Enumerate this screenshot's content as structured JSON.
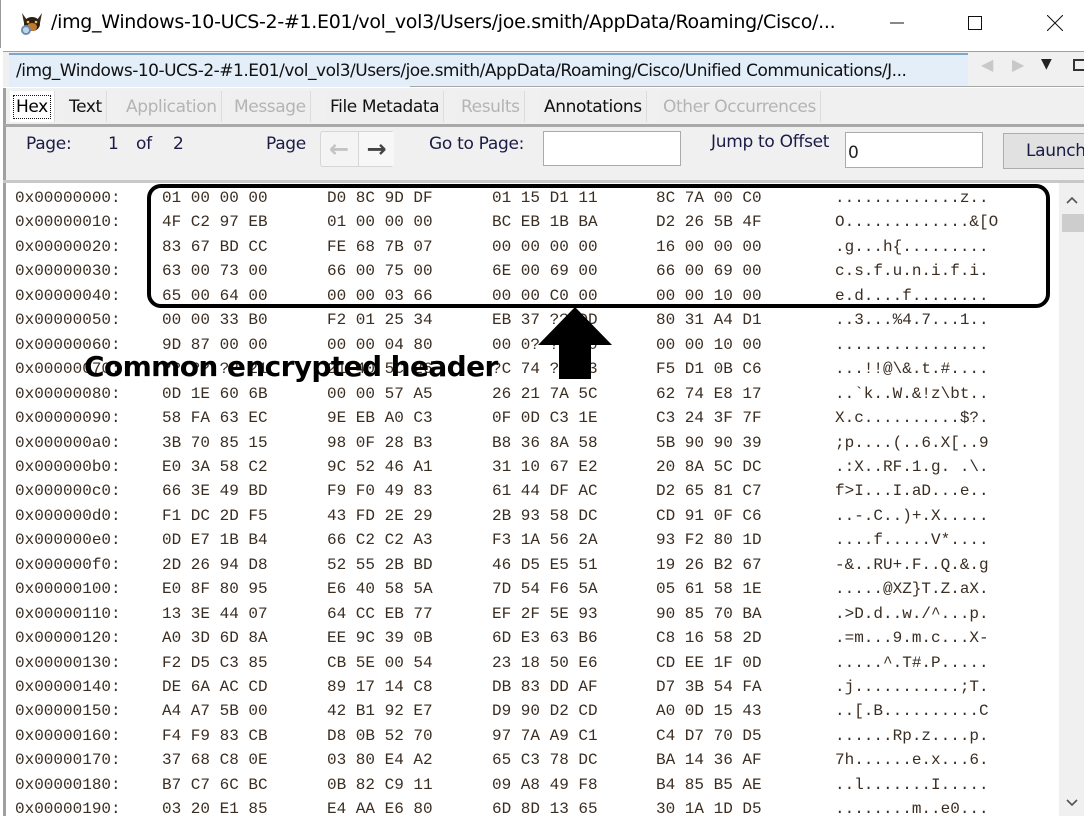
{
  "window": {
    "title": "/img_Windows-10-UCS-2-#1.E01/vol_vol3/Users/joe.smith/AppData/Roaming/Cisco/...",
    "minimize_glyph": "—",
    "maximize_glyph": "☐",
    "close_glyph": "✕",
    "icon": "app-dog-magnifier-icon"
  },
  "path_tab": {
    "label": "/img_Windows-10-UCS-2-#1.E01/vol_vol3/Users/joe.smith/AppData/Roaming/Cisco/Unified Communications/J...",
    "prev_glyph": "◀",
    "next_glyph": "▶",
    "menu_glyph": "▼"
  },
  "viewer_tabs": [
    {
      "label": "Hex",
      "state": "active"
    },
    {
      "label": "Text",
      "state": "enabled"
    },
    {
      "label": "Application",
      "state": "disabled"
    },
    {
      "label": "Message",
      "state": "disabled"
    },
    {
      "label": "File Metadata",
      "state": "enabled"
    },
    {
      "label": "Results",
      "state": "disabled"
    },
    {
      "label": "Annotations",
      "state": "enabled"
    },
    {
      "label": "Other Occurrences",
      "state": "disabled"
    }
  ],
  "toolbar": {
    "page_label": "Page:",
    "page_current": "1",
    "of_label": "of",
    "page_total": "2",
    "page_nav_label": "Page",
    "prev_glyph": "←",
    "next_glyph": "→",
    "goto_label": "Go to Page:",
    "goto_value": "",
    "jump_label": "Jump to Offset",
    "jump_value": "0",
    "launch_label": "Launch"
  },
  "hex_rows": [
    {
      "offset": "0x00000000:",
      "g1": "01 00 00 00",
      "g2": "D0 8C 9D DF",
      "g3": "01 15 D1 11",
      "g4": "8C 7A 00 C0",
      "ascii": ".............z.."
    },
    {
      "offset": "0x00000010:",
      "g1": "4F C2 97 EB",
      "g2": "01 00 00 00",
      "g3": "BC EB 1B BA",
      "g4": "D2 26 5B 4F",
      "ascii": "O.............&[O"
    },
    {
      "offset": "0x00000020:",
      "g1": "83 67 BD CC",
      "g2": "FE 68 7B 07",
      "g3": "00 00 00 00",
      "g4": "16 00 00 00",
      "ascii": ".g...h{........."
    },
    {
      "offset": "0x00000030:",
      "g1": "63 00 73 00",
      "g2": "66 00 75 00",
      "g3": "6E 00 69 00",
      "g4": "66 00 69 00",
      "ascii": "c.s.f.u.n.i.f.i."
    },
    {
      "offset": "0x00000040:",
      "g1": "65 00 64 00",
      "g2": "00 00 03 66",
      "g3": "00 00 C0 00",
      "g4": "00 00 10 00",
      "ascii": "e.d....f........"
    },
    {
      "offset": "0x00000050:",
      "g1": "00 00 33 B0",
      "g2": "F2 01 25 34",
      "g3": "EB 37 ?? DD",
      "g4": "80 31 A4 D1",
      "ascii": "..3...%4.7...1.."
    },
    {
      "offset": "0x00000060:",
      "g1": "9D 87 00 00",
      "g2": "00 00 04 80",
      "g3": "00 0? ?? ?0",
      "g4": "00 00 10 00",
      "ascii": "................"
    },
    {
      "offset": "0x00000070:",
      "g1": "?? ?? ?? 21",
      "g2": "21 40 5C 26",
      "g3": "?C 74 ?? 23",
      "g4": "F5 D1 0B C6",
      "ascii": "...!!@\\&.t.#...."
    },
    {
      "offset": "0x00000080:",
      "g1": "0D 1E 60 6B",
      "g2": "00 00 57 A5",
      "g3": "26 21 7A 5C",
      "g4": "62 74 E8 17",
      "ascii": "..`k..W.&!z\\bt.."
    },
    {
      "offset": "0x00000090:",
      "g1": "58 FA 63 EC",
      "g2": "9E EB A0 C3",
      "g3": "0F 0D C3 1E",
      "g4": "C3 24 3F 7F",
      "ascii": "X.c..........$?."
    },
    {
      "offset": "0x000000a0:",
      "g1": "3B 70 85 15",
      "g2": "98 0F 28 B3",
      "g3": "B8 36 8A 58",
      "g4": "5B 90 90 39",
      "ascii": ";p....(..6.X[..9"
    },
    {
      "offset": "0x000000b0:",
      "g1": "E0 3A 58 C2",
      "g2": "9C 52 46 A1",
      "g3": "31 10 67 E2",
      "g4": "20 8A 5C DC",
      "ascii": ".:X..RF.1.g. .\\."
    },
    {
      "offset": "0x000000c0:",
      "g1": "66 3E 49 BD",
      "g2": "F9 F0 49 83",
      "g3": "61 44 DF AC",
      "g4": "D2 65 81 C7",
      "ascii": "f>I...I.aD...e.."
    },
    {
      "offset": "0x000000d0:",
      "g1": "F1 DC 2D F5",
      "g2": "43 FD 2E 29",
      "g3": "2B 93 58 DC",
      "g4": "CD 91 0F C6",
      "ascii": "..-.C..)+.X....."
    },
    {
      "offset": "0x000000e0:",
      "g1": "0D E7 1B B4",
      "g2": "66 C2 C2 A3",
      "g3": "F3 1A 56 2A",
      "g4": "93 F2 80 1D",
      "ascii": "....f.....V*...."
    },
    {
      "offset": "0x000000f0:",
      "g1": "2D 26 94 D8",
      "g2": "52 55 2B BD",
      "g3": "46 D5 E5 51",
      "g4": "19 26 B2 67",
      "ascii": "-&..RU+.F..Q.&.g"
    },
    {
      "offset": "0x00000100:",
      "g1": "E0 8F 80 95",
      "g2": "E6 40 58 5A",
      "g3": "7D 54 F6 5A",
      "g4": "05 61 58 1E",
      "ascii": ".....@XZ}T.Z.aX."
    },
    {
      "offset": "0x00000110:",
      "g1": "13 3E 44 07",
      "g2": "64 CC EB 77",
      "g3": "EF 2F 5E 93",
      "g4": "90 85 70 BA",
      "ascii": ".>D.d..w./^...p."
    },
    {
      "offset": "0x00000120:",
      "g1": "A0 3D 6D 8A",
      "g2": "EE 9C 39 0B",
      "g3": "6D E3 63 B6",
      "g4": "C8 16 58 2D",
      "ascii": ".=m...9.m.c...X-"
    },
    {
      "offset": "0x00000130:",
      "g1": "F2 D5 C3 85",
      "g2": "CB 5E 00 54",
      "g3": "23 18 50 E6",
      "g4": "CD EE 1F 0D",
      "ascii": ".....^.T#.P....."
    },
    {
      "offset": "0x00000140:",
      "g1": "DE 6A AC CD",
      "g2": "89 17 14 C8",
      "g3": "DB 83 DD AF",
      "g4": "D7 3B 54 FA",
      "ascii": ".j...........;T."
    },
    {
      "offset": "0x00000150:",
      "g1": "A4 A7 5B 00",
      "g2": "42 B1 92 E7",
      "g3": "D9 90 D2 CD",
      "g4": "A0 0D 15 43",
      "ascii": "..[.B..........C"
    },
    {
      "offset": "0x00000160:",
      "g1": "F4 F9 83 CB",
      "g2": "D8 0B 52 70",
      "g3": "97 7A A9 C1",
      "g4": "C4 D7 70 D5",
      "ascii": "......Rp.z....p."
    },
    {
      "offset": "0x00000170:",
      "g1": "37 68 C8 0E",
      "g2": "03 80 E4 A2",
      "g3": "65 C3 78 DC",
      "g4": "BA 14 36 AF",
      "ascii": "7h......e.x...6."
    },
    {
      "offset": "0x00000180:",
      "g1": "B7 C7 6C BC",
      "g2": "0B 82 C9 11",
      "g3": "09 A8 49 F8",
      "g4": "B4 85 B5 AE",
      "ascii": "..l.......I....."
    },
    {
      "offset": "0x00000190:",
      "g1": "03 20 E1 85",
      "g2": "E4 AA E6 80",
      "g3": "6D 8D 13 65",
      "g4": "30 1A 1D D5",
      "ascii": "........m..e0..."
    }
  ],
  "scrollbar": {
    "up_glyph": "⌃",
    "down_glyph": "⌄"
  },
  "annotation": {
    "label": "Common encrypted header",
    "highlighted_range": "0x00000000-0x0000004F"
  }
}
